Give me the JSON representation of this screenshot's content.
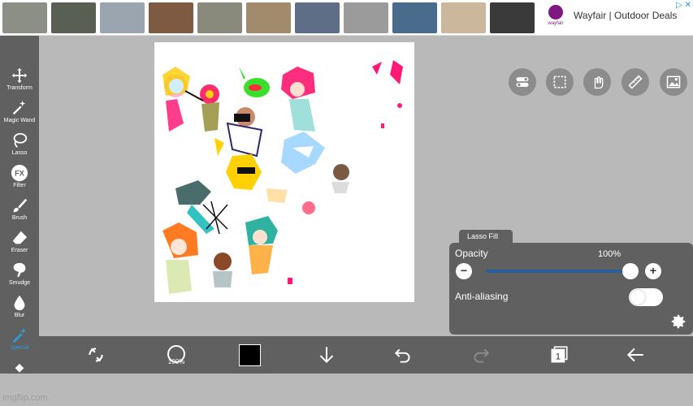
{
  "ad": {
    "text": "Wayfair | Outdoor Deals",
    "brand_word": "wayfair",
    "close_label": "▷ ✕",
    "thumbnail_colors": [
      "#8c8f86",
      "#5a5f53",
      "#9aa5b0",
      "#7e5a43",
      "#8a8a7c",
      "#a28b6d",
      "#5e6e86",
      "#9b9b9b",
      "#4a6c8c",
      "#cbb79c",
      "#3a3a3a"
    ]
  },
  "left_toolbar": {
    "tools": [
      {
        "label": "Transform",
        "icon": "move-arrows-icon"
      },
      {
        "label": "Magic Wand",
        "icon": "magic-wand-icon"
      },
      {
        "label": "Lasso",
        "icon": "lasso-icon"
      },
      {
        "label": "Filter",
        "icon": "fx-icon"
      },
      {
        "label": "Brush",
        "icon": "brush-icon"
      },
      {
        "label": "Eraser",
        "icon": "eraser-icon"
      },
      {
        "label": "Smudge",
        "icon": "smudge-icon"
      },
      {
        "label": "Blur",
        "icon": "blur-drop-icon"
      },
      {
        "label": "Special",
        "icon": "special-wand-icon",
        "active": true
      }
    ]
  },
  "top_right_buttons": [
    "layer-toggle-icon",
    "selection-icon",
    "hand-icon",
    "ruler-icon",
    "image-icon"
  ],
  "lasso_panel": {
    "tab_label": "Lasso Fill",
    "opacity_label": "Opacity",
    "opacity_value": "100%",
    "opacity_fraction": 1.0,
    "minus_label": "−",
    "plus_label": "+",
    "antialias_label": "Anti-aliasing",
    "antialias_on": false
  },
  "bottom_toolbar": {
    "brush_size_label": "100%",
    "current_color": "#000000",
    "layer_count": "1"
  },
  "watermark": "imgflip.com",
  "colors": {
    "toolbar_bg": "#606060",
    "workspace_bg": "#b9b9b9",
    "accent": "#2d9cdb",
    "slider_fill": "#2a5f9e"
  }
}
